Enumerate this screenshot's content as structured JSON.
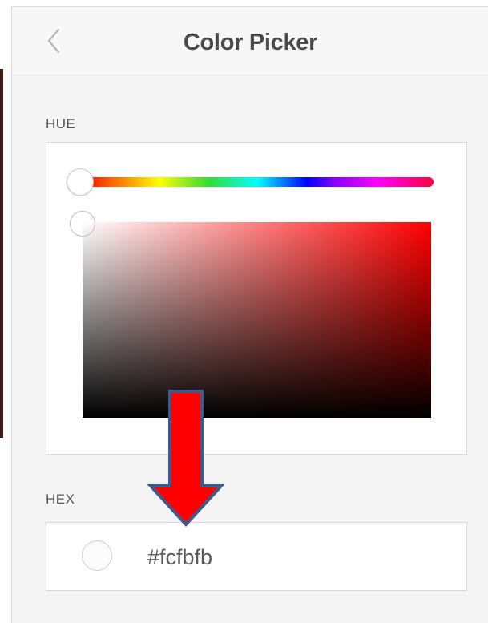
{
  "header": {
    "title": "Color Picker",
    "back_icon": "chevron-left-icon"
  },
  "hue_section": {
    "label": "HUE",
    "hue_position_fraction": 0.0,
    "saturation_fraction": 0.0,
    "value_fraction": 1.0
  },
  "hex_section": {
    "label": "HEX",
    "value": "#fcfbfb",
    "swatch_color": "#fcfbfb"
  },
  "annotation": {
    "arrow_color": "#ff0000",
    "arrow_outline_color": "#3f5a8a",
    "direction": "down"
  }
}
